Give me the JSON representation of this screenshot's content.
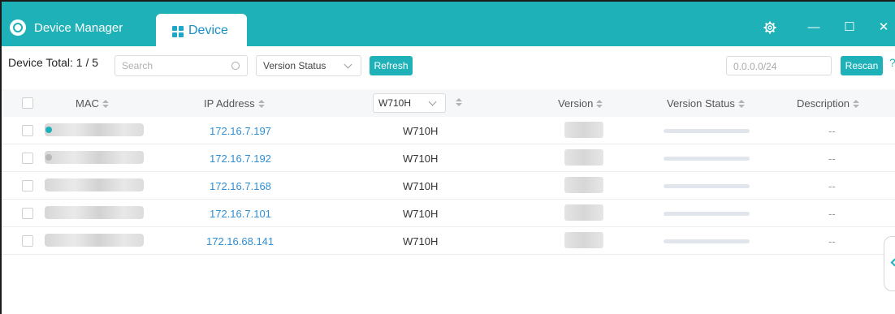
{
  "titlebar": {
    "app_title": "Device Manager",
    "tab_label": "Device",
    "settings_icon": "gear-icon",
    "minimize_glyph": "—",
    "maximize_glyph": "☐",
    "close_glyph": "✕",
    "accent_color": "#1fb1b8"
  },
  "toolbar": {
    "device_total_label": "Device Total:",
    "device_total_value": "1 / 5",
    "search_placeholder": "Search",
    "version_status_select": "Version Status",
    "refresh_label": "Refresh",
    "ip_range_placeholder": "0.0.0.0/24",
    "rescan_label": "Rescan",
    "help_glyph": "?"
  },
  "table": {
    "headers": {
      "mac": "MAC",
      "ip": "IP Address",
      "model_filter": "W710H",
      "version": "Version",
      "version_status": "Version Status",
      "description": "Description"
    },
    "rows": [
      {
        "ip": "172.16.7.197",
        "model": "W710H",
        "description": "--",
        "status": "online"
      },
      {
        "ip": "172.16.7.192",
        "model": "W710H",
        "description": "--",
        "status": "offline"
      },
      {
        "ip": "172.16.7.168",
        "model": "W710H",
        "description": "--",
        "status": "none"
      },
      {
        "ip": "172.16.7.101",
        "model": "W710H",
        "description": "--",
        "status": "none"
      },
      {
        "ip": "172.16.68.141",
        "model": "W710H",
        "description": "--",
        "status": "none"
      }
    ]
  }
}
